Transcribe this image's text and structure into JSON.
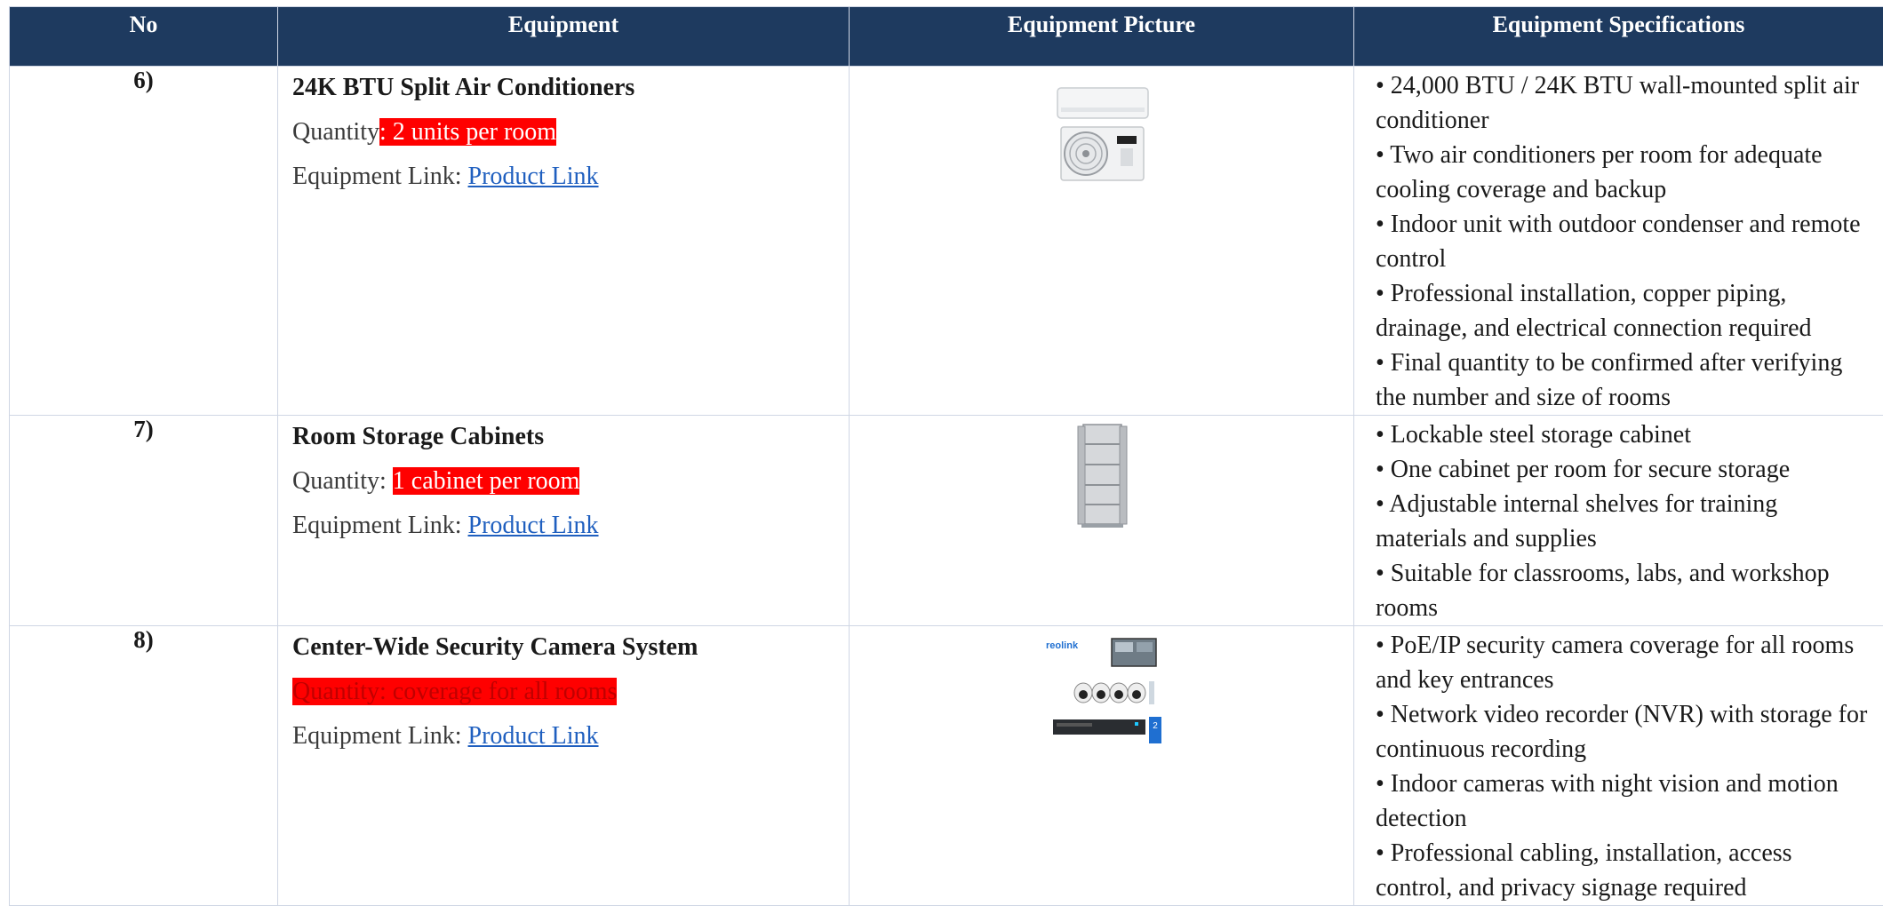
{
  "headers": [
    "No",
    "Equipment",
    "Equipment Picture",
    "Equipment Specifications"
  ],
  "rows": [
    {
      "no": "6)",
      "name": "24K BTU Split Air Conditioners",
      "quantity_prefix": "Quantity",
      "quantity_value": ": 2 units per room",
      "link_prefix": "Equipment Link: ",
      "link_text": "Product Link",
      "picture_icon": "split-air-conditioner",
      "specs": [
        "• 24,000 BTU / 24K BTU wall-mounted split air conditioner",
        "• Two air conditioners per room for adequate cooling coverage and backup",
        "• Indoor unit with outdoor condenser and remote control",
        "• Professional installation, copper piping, drainage, and electrical connection required",
        "• Final quantity to be confirmed after verifying the number and size of rooms"
      ]
    },
    {
      "no": "7)",
      "name": "Room Storage Cabinets",
      "quantity_prefix": "Quantity: ",
      "quantity_value": "1 cabinet per room",
      "link_prefix": "Equipment Link: ",
      "link_text": "Product Link",
      "picture_icon": "steel-cabinet",
      "specs": [
        "• Lockable steel storage cabinet",
        "• One cabinet per room for secure storage",
        "• Adjustable internal shelves for training materials and supplies",
        "• Suitable for classrooms, labs, and workshop rooms"
      ]
    },
    {
      "no": "8)",
      "name": "Center-Wide Security Camera System",
      "quantity_full": "Quantity: coverage for all rooms",
      "link_prefix": "Equipment Link: ",
      "link_text": "Product Link",
      "picture_icon": "security-camera-kit",
      "picture_brand": "reolink",
      "specs": [
        "• PoE/IP security camera coverage for all rooms and key entrances",
        "• Network video recorder (NVR) with storage for continuous recording",
        "• Indoor cameras with night vision and motion detection",
        "• Professional cabling, installation, access control, and privacy signage required"
      ]
    }
  ]
}
